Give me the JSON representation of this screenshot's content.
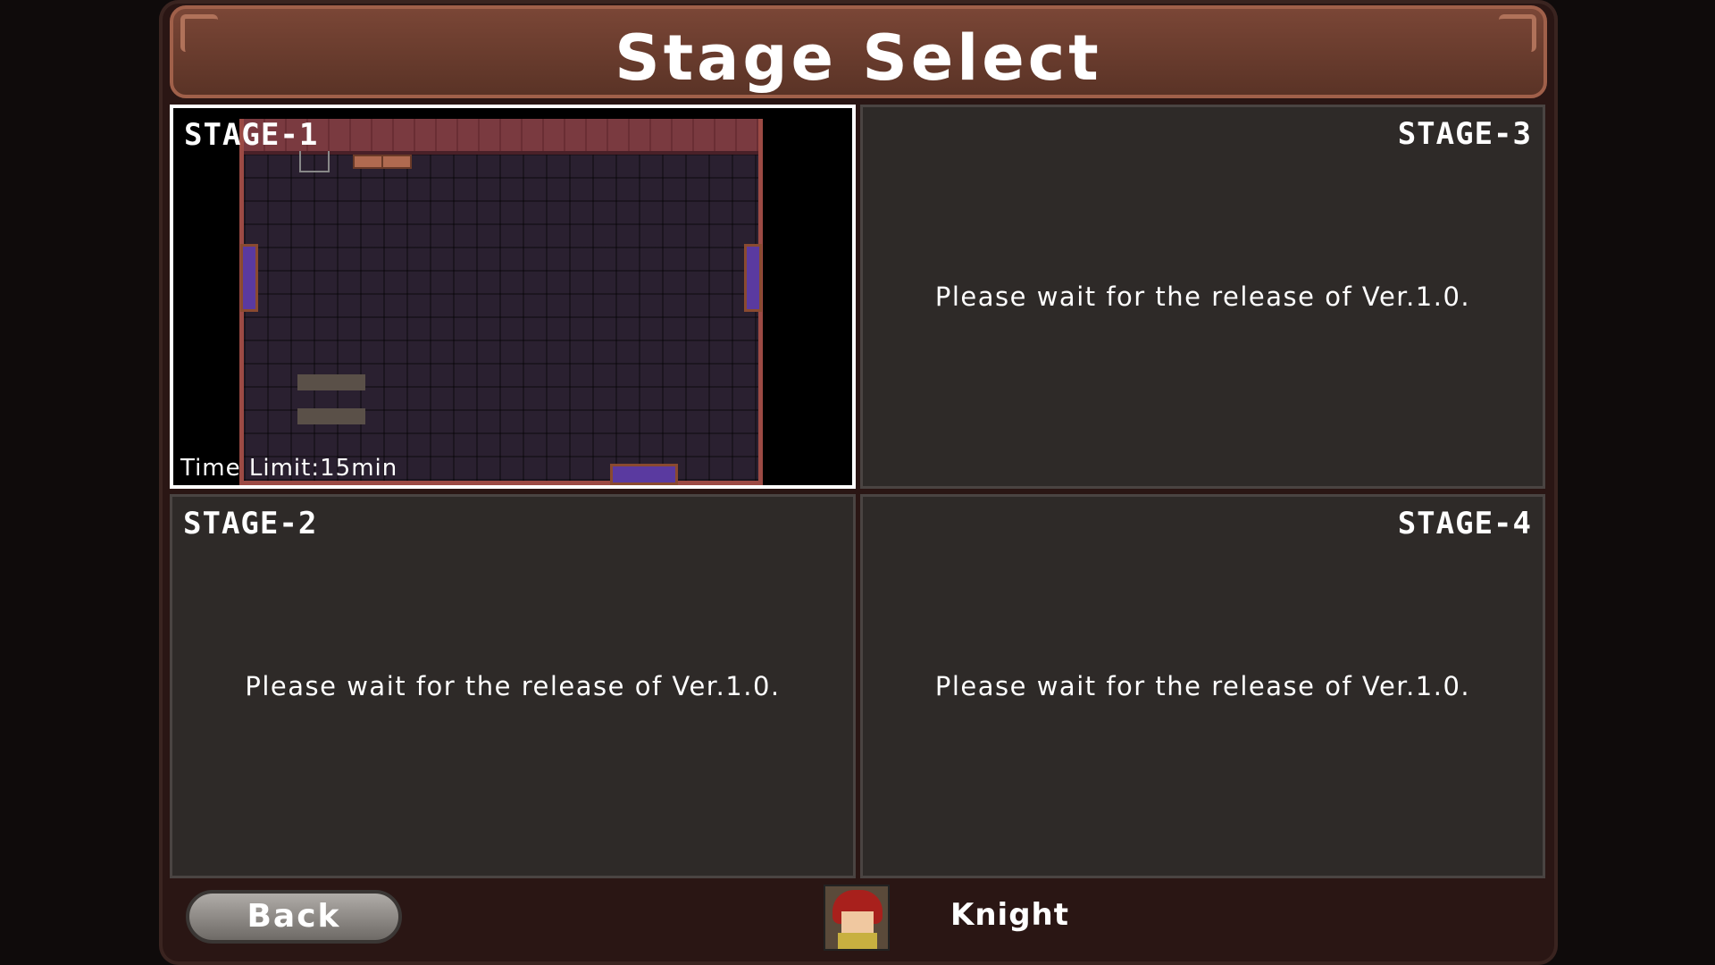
{
  "screen": {
    "title": "Stage Select"
  },
  "stages": [
    {
      "label": "STAGE-1",
      "time_limit": "Time Limit:15min",
      "selected": true
    },
    {
      "label": "STAGE-2",
      "message": "Please wait for the release of Ver.1.0."
    },
    {
      "label": "STAGE-3",
      "message": "Please wait for the release of Ver.1.0."
    },
    {
      "label": "STAGE-4",
      "message": "Please wait for the release of Ver.1.0."
    }
  ],
  "footer": {
    "back_label": "Back",
    "character_name": "Knight",
    "character_icon": "knight-portrait-icon"
  },
  "colors": {
    "background": "#0f0b0b",
    "title_bar": "#6a3a2c",
    "panel": "#2e2a28",
    "selected_border": "#ffffff"
  }
}
